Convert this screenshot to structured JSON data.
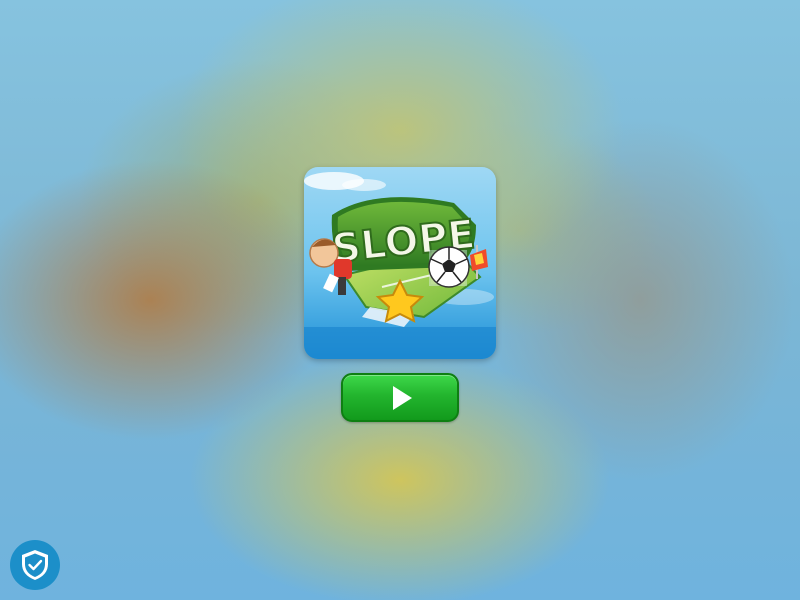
{
  "game": {
    "title": "SLOPE",
    "play_icon": "play-icon",
    "tile_icon": "game-thumbnail"
  },
  "privacy": {
    "icon": "shield-check-icon"
  },
  "colors": {
    "play_button": "#23b52e",
    "shield_button": "#1c8fc9",
    "logo_green": "#3f8a2a"
  }
}
